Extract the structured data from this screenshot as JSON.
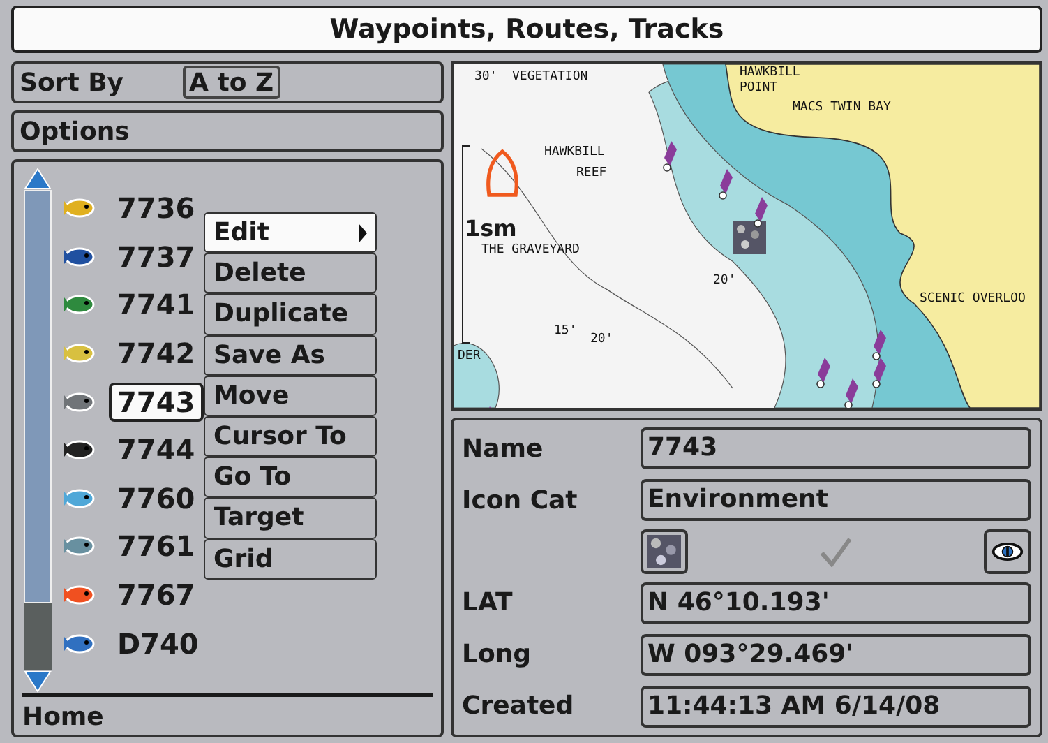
{
  "window": {
    "title": "Waypoints, Routes, Tracks"
  },
  "sort": {
    "label": "Sort By",
    "value": "A to Z"
  },
  "options": {
    "label": "Options"
  },
  "waypoints": [
    {
      "name": "7736",
      "selected": false
    },
    {
      "name": "7737",
      "selected": false
    },
    {
      "name": "7741",
      "selected": false
    },
    {
      "name": "7742",
      "selected": false
    },
    {
      "name": "7743",
      "selected": true
    },
    {
      "name": "7744",
      "selected": false
    },
    {
      "name": "7760",
      "selected": false
    },
    {
      "name": "7761",
      "selected": false
    },
    {
      "name": "7767",
      "selected": false
    },
    {
      "name": "D740",
      "selected": false
    }
  ],
  "menu": [
    {
      "label": "Edit",
      "selected": true,
      "submenu": true
    },
    {
      "label": "Delete",
      "selected": false,
      "submenu": false
    },
    {
      "label": "Duplicate",
      "selected": false,
      "submenu": false
    },
    {
      "label": "Save As",
      "selected": false,
      "submenu": false
    },
    {
      "label": "Move",
      "selected": false,
      "submenu": false
    },
    {
      "label": "Cursor To",
      "selected": false,
      "submenu": false
    },
    {
      "label": "Go To",
      "selected": false,
      "submenu": false
    },
    {
      "label": "Target",
      "selected": false,
      "submenu": false
    },
    {
      "label": "Grid",
      "selected": false,
      "submenu": false
    }
  ],
  "footer": {
    "label": "Home"
  },
  "map": {
    "scale": "1sm",
    "labels": [
      "30'",
      "VEGETATION",
      "HAWKBILL",
      "POINT",
      "MACS TWIN BAY",
      "HAWKBILL",
      "REEF",
      "THE GRAVEYARD",
      "20'",
      "SCENIC OVERLOO",
      "15'",
      "20'",
      "DER"
    ]
  },
  "details": {
    "name_label": "Name",
    "name_value": "7743",
    "icon_label": "Icon Cat",
    "icon_value": "Environment",
    "visible": true,
    "fields": [
      {
        "label": "LAT",
        "value": "N 46°10.193'"
      },
      {
        "label": "Long",
        "value": "W 093°29.469'"
      },
      {
        "label": "Created",
        "value": "11:44:13 AM 6/14/08"
      }
    ]
  }
}
